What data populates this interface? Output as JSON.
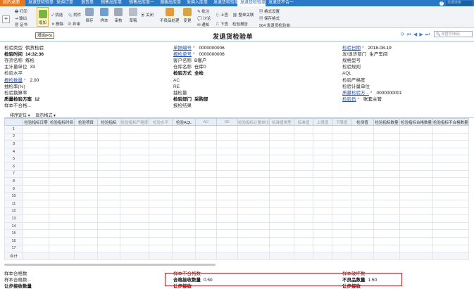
{
  "tabs": [
    "我的桌面",
    "发退货检验单",
    "采购订单",
    "退货单",
    "销售出库单",
    "销售出库单一",
    "调拨出库单",
    "采购入库单",
    "发退货检验单",
    "发退货检验单",
    "发退货不合一"
  ],
  "active_tab": 9,
  "top_search": "单据搜索",
  "toolbar": {
    "print": "打印",
    "export": "输出",
    "cert": "证书",
    "add": "增加",
    "check": "挑选",
    "attach": "附件",
    "delete": "删除",
    "discard": "弃审",
    "save": "保存",
    "sample": "样本",
    "audit": "审核",
    "draft": "草稿",
    "submit": "审核",
    "close": "关闭",
    "disposal": "不良品处理",
    "change": "变更",
    "approve": "批注",
    "discuss": "讨论",
    "notify": "通知",
    "prev_doc": "上查",
    "next_doc": "下查",
    "link": "整单关联",
    "report": "检验报告",
    "fmt_set": "格式设置",
    "fmt_save": "保存格式",
    "fmt_name": "564 发退货检验单·"
  },
  "tooltip": "增加(F5)",
  "page": {
    "title": "发退货检验单",
    "search": "单据号/条码"
  },
  "header": {
    "col1": [
      {
        "l": "检验类型",
        "v": "供货检验",
        "s": "n"
      },
      {
        "l": "检验时间",
        "v": "14:32:36",
        "s": "b"
      },
      {
        "l": "存货名称",
        "v": "练检",
        "s": "n"
      },
      {
        "l": "主计量单位",
        "v": "33",
        "s": "n"
      },
      {
        "l": "检验水平",
        "v": "",
        "s": "n"
      },
      {
        "l": "报检数量",
        "v": "2.00",
        "s": "k",
        "r": true
      },
      {
        "l": "抽检率(%)",
        "v": "",
        "s": "n"
      },
      {
        "l": "检验换算率",
        "v": "",
        "s": "n"
      },
      {
        "l": "质量检验方案",
        "v": "12",
        "s": "b"
      },
      {
        "l": "样本不合格...",
        "v": "",
        "s": "n"
      }
    ],
    "col2": [
      {
        "l": "单据编号",
        "v": "0000000006",
        "s": "k",
        "r": true
      },
      {
        "l": "报检单号",
        "v": "0000000006",
        "s": "k",
        "r": true
      },
      {
        "l": "客户名称",
        "v": "B客户",
        "s": "n"
      },
      {
        "l": "仓库名称",
        "v": "仓库0",
        "s": "n"
      },
      {
        "l": "检验方式",
        "v": "全检",
        "s": "b"
      },
      {
        "l": "AC",
        "v": "",
        "s": "n"
      },
      {
        "l": "RE",
        "v": "",
        "s": "n"
      },
      {
        "l": "抽检量",
        "v": "",
        "s": "n"
      },
      {
        "l": "检验部门",
        "v": "采购部",
        "s": "b"
      },
      {
        "l": "报检结果",
        "v": "",
        "s": "n"
      }
    ],
    "col3": [
      {
        "l": "检验日期",
        "v": "2018-08-19",
        "s": "k",
        "r": true
      },
      {
        "l": "发/退货部门",
        "v": "生产车间",
        "s": "n"
      },
      {
        "l": "规格型号",
        "v": "",
        "s": "n"
      },
      {
        "l": "检验规则",
        "v": "",
        "s": "n"
      },
      {
        "l": "AQL",
        "v": "",
        "s": "n"
      },
      {
        "l": "检验严格度",
        "v": "",
        "s": "n"
      },
      {
        "l": "检验计量单位",
        "v": "",
        "s": "n"
      },
      {
        "l": "质量检验方...",
        "v": "0000000001",
        "s": "k",
        "r": true
      },
      {
        "l": "检验员",
        "v": "账套主管",
        "s": "k",
        "r": true
      }
    ]
  },
  "grid_toolbar": {
    "sort": "排序定位",
    "display": "显示格式"
  },
  "grid": {
    "columns": [
      "检验指标日期",
      "检验指标时间",
      "检验项目",
      "检验指标",
      "检验指标严格度",
      "检验水平",
      "检验AQL",
      "AC",
      "RE",
      "检验指标计量单位",
      "标准值类型",
      "标准值",
      "上限值",
      "下限值",
      "检测值",
      "检验指标数量",
      "检验指标合格数量",
      "检验指标不合格数量"
    ],
    "dim_columns": [
      4,
      5,
      7,
      8,
      9,
      10,
      11,
      12,
      13
    ],
    "rows": [
      "1",
      "2",
      "3",
      "4",
      "5",
      "6",
      "7",
      "8",
      "9",
      "10",
      "11",
      "12",
      "13",
      "14",
      "15",
      "16",
      "17"
    ],
    "total": "合计"
  },
  "footer": [
    {
      "l": "样本合格数",
      "v": "",
      "s": "n",
      "col": 0,
      "row": 0
    },
    {
      "l": "样本不合格数",
      "v": "",
      "s": "n",
      "col": 1,
      "row": 0
    },
    {
      "l": "样本破坏数",
      "v": "",
      "s": "n",
      "col": 2,
      "row": 0
    },
    {
      "l": "样本合格数...",
      "v": "",
      "s": "n",
      "col": 0,
      "row": 1
    },
    {
      "l": "合格接收数量",
      "v": "0.50",
      "s": "b",
      "col": 1,
      "row": 1
    },
    {
      "l": "不良品数量",
      "v": "1.50",
      "s": "b",
      "col": 2,
      "row": 1
    },
    {
      "l": "让步接收数量",
      "v": "",
      "s": "b",
      "col": 0,
      "row": 2
    },
    {
      "l": "让步接收",
      "v": "",
      "s": "b",
      "col": 1,
      "row": 2
    },
    {
      "l": "让步接收",
      "v": "",
      "s": "b",
      "col": 2,
      "row": 2
    }
  ]
}
